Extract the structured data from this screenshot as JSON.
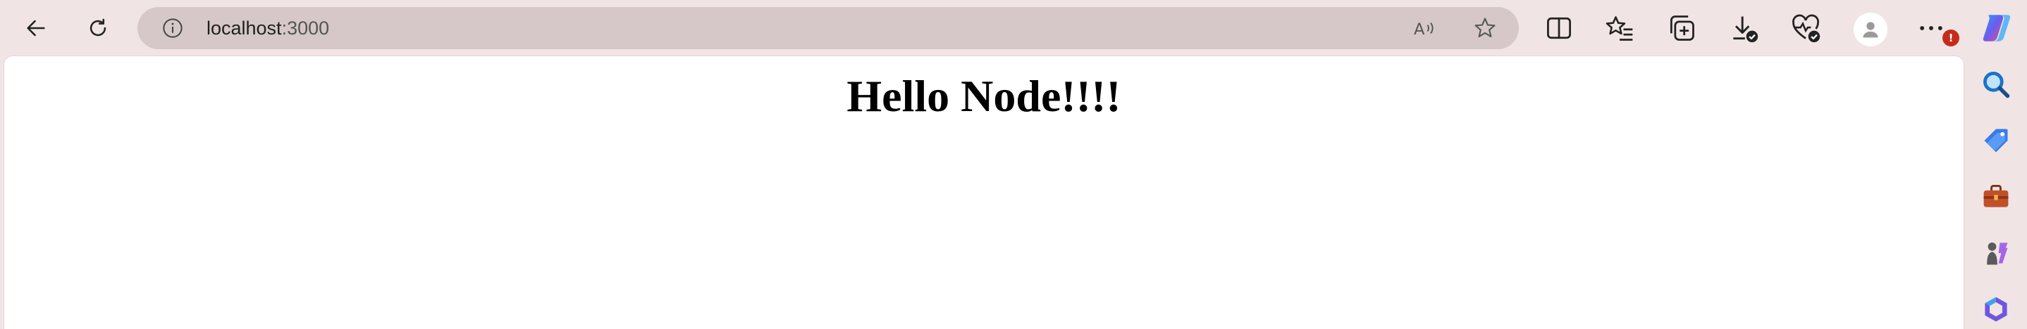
{
  "browser": {
    "address_bar": {
      "url_host": "localhost",
      "url_port": ":3000"
    },
    "toolbar": {
      "notification_badge": "!"
    },
    "icons": {
      "back": "back-arrow-icon",
      "reload": "reload-icon",
      "info": "site-info-icon",
      "read_aloud": "read-aloud-icon",
      "favorite": "favorite-star-icon",
      "split_screen": "split-screen-icon",
      "favorites": "favorites-icon",
      "collections": "collections-icon",
      "downloads": "downloads-icon",
      "health": "browser-essentials-icon",
      "profile": "profile-icon",
      "more": "more-icon",
      "copilot": "copilot-icon",
      "sidebar": [
        "search-icon",
        "shopping-tag-icon",
        "tools-briefcase-icon",
        "games-icon",
        "office-icon"
      ]
    },
    "colors": {
      "frame": "#f1e4e4",
      "address_bg": "#d6c8c8",
      "page_bg": "#ffffff",
      "badge": "#c42b1c"
    }
  },
  "page": {
    "heading": "Hello Node!!!!"
  }
}
